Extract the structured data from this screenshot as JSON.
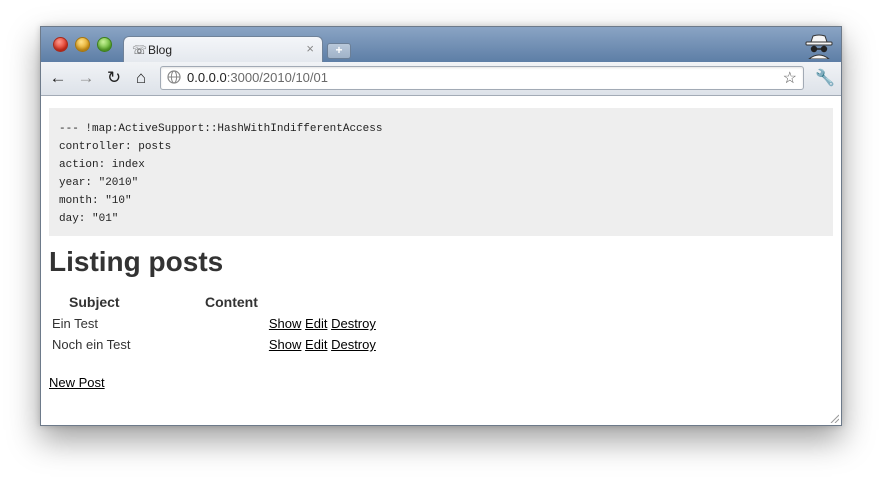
{
  "browser": {
    "tab_title": "Blog",
    "tab_close": "×",
    "new_tab": "+",
    "url_host": "0.0.0.0",
    "url_rest": ":3000/2010/10/01",
    "back": "←",
    "forward": "→",
    "reload": "↻",
    "home": "⌂",
    "star": "☆",
    "wrench": "🔧"
  },
  "debug": {
    "lines": [
      "--- !map:ActiveSupport::HashWithIndifferentAccess",
      "controller: posts",
      "action: index",
      "year: \"2010\"",
      "month: \"10\"",
      "day: \"01\""
    ]
  },
  "page": {
    "heading": "Listing posts",
    "columns": {
      "subject": "Subject",
      "content": "Content"
    },
    "rows": [
      {
        "subject": "Ein Test",
        "content": "",
        "show": "Show",
        "edit": "Edit",
        "destroy": "Destroy"
      },
      {
        "subject": "Noch ein Test",
        "content": "",
        "show": "Show",
        "edit": "Edit",
        "destroy": "Destroy"
      }
    ],
    "new_post": "New Post"
  }
}
